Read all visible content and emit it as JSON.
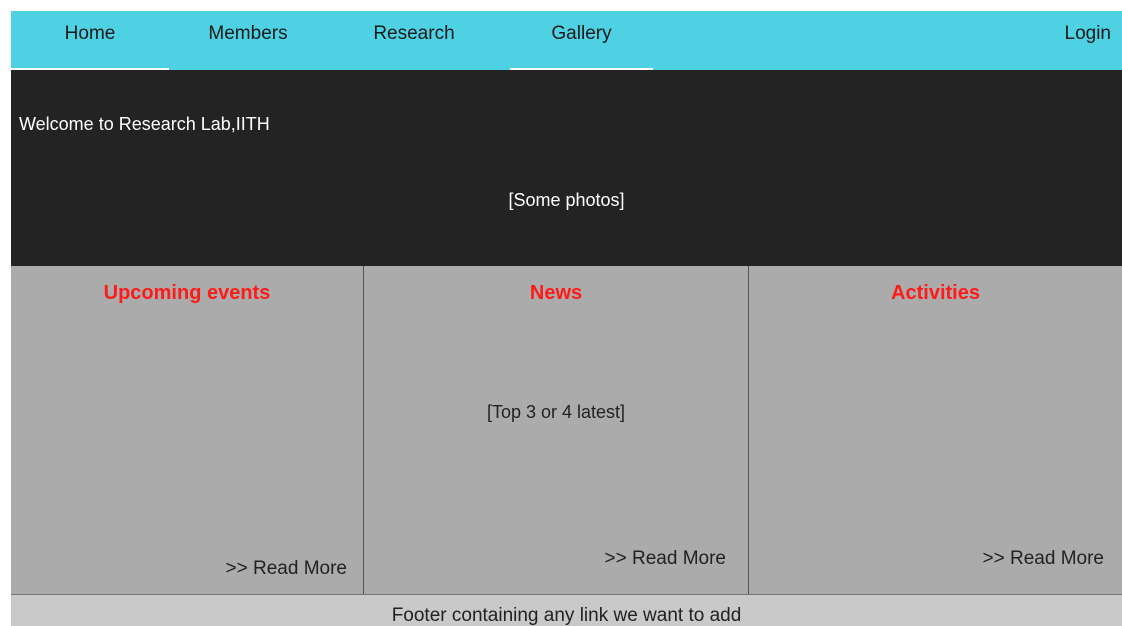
{
  "nav": {
    "items": [
      {
        "label": "Home"
      },
      {
        "label": "Members"
      },
      {
        "label": "Research"
      },
      {
        "label": "Gallery"
      }
    ],
    "login_label": "Login",
    "colors": {
      "background": "#4dd1e3"
    }
  },
  "hero": {
    "title": "Welcome to Research Lab,IITH",
    "photos_placeholder": "[Some photos]",
    "colors": {
      "background": "#232323"
    }
  },
  "sections": {
    "events": {
      "heading": "Upcoming events",
      "read_more": ">> Read More"
    },
    "news": {
      "heading": "News",
      "body": "[Top 3 or 4 latest]",
      "read_more": ">> Read More"
    },
    "activities": {
      "heading": "Activities",
      "read_more": ">> Read More"
    },
    "colors": {
      "heading": "#ff1a1a",
      "background": "#ababab"
    }
  },
  "footer": {
    "text": "Footer containing any link we want to add"
  }
}
